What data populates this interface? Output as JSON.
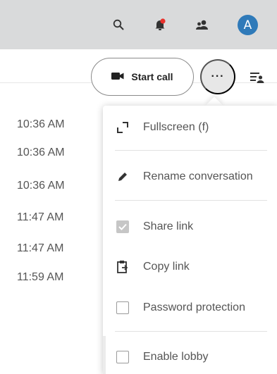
{
  "topbar": {
    "avatar_initial": "A",
    "icons": [
      "search-icon",
      "notifications-icon",
      "contacts-icon"
    ],
    "notification_dot_color": "#e9322d"
  },
  "header": {
    "start_call_label": "Start call",
    "more_label": "···"
  },
  "messages": {
    "times": [
      "10:36 AM",
      "10:36 AM",
      "10:36 AM",
      "11:47 AM",
      "11:47 AM",
      "11:59 AM"
    ]
  },
  "menu": {
    "fullscreen_label": "Fullscreen (f)",
    "rename_label": "Rename conversation",
    "share_link_label": "Share link",
    "share_link_checked": true,
    "copy_link_label": "Copy link",
    "password_label": "Password protection",
    "password_checked": false,
    "lobby_label": "Enable lobby",
    "lobby_checked": false
  },
  "colors": {
    "topbar_bg": "#d9dadb",
    "avatar_bg": "#2f7ab9",
    "text_muted": "#555555"
  }
}
